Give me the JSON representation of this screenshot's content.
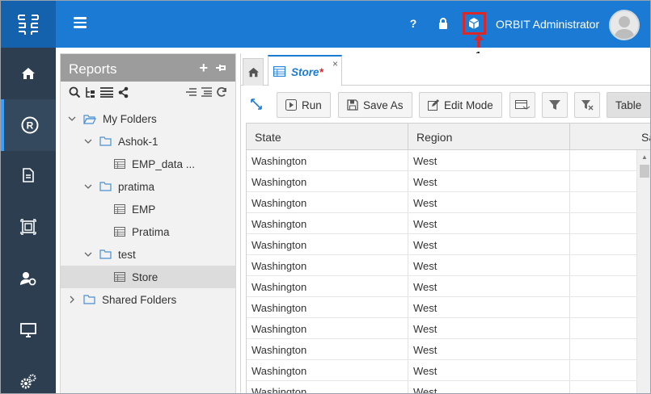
{
  "header": {
    "admin_name": "ORBIT Administrator",
    "callout_number": "1",
    "icons": [
      "menu-icon",
      "help-icon",
      "lock-icon",
      "cube-icon",
      "user-avatar"
    ]
  },
  "leftnav": {
    "items": [
      "home-icon",
      "registered-icon",
      "document-icon",
      "dashboard-icon",
      "user-gear-icon",
      "monitor-icon",
      "settings-icon"
    ]
  },
  "reports": {
    "title": "Reports",
    "tree": [
      {
        "label": "My Folders",
        "type": "folder-open",
        "level": 0,
        "expanded": true
      },
      {
        "label": "Ashok-1",
        "type": "folder",
        "level": 1,
        "expanded": true
      },
      {
        "label": "EMP_data ...",
        "type": "report",
        "level": 2
      },
      {
        "label": "pratima",
        "type": "folder",
        "level": 1,
        "expanded": true
      },
      {
        "label": "EMP",
        "type": "report",
        "level": 2
      },
      {
        "label": "Pratima",
        "type": "report",
        "level": 2
      },
      {
        "label": "test",
        "type": "folder",
        "level": 1,
        "expanded": true
      },
      {
        "label": "Store",
        "type": "report",
        "level": 2,
        "selected": true
      },
      {
        "label": "Shared Folders",
        "type": "folder",
        "level": 0,
        "expanded": false
      }
    ]
  },
  "tabs": {
    "store_label": "Store",
    "modified_marker": "*",
    "close_symbol": "×"
  },
  "toolbar": {
    "run_label": "Run",
    "save_as_label": "Save As",
    "edit_mode_label": "Edit Mode",
    "table_label": "Table"
  },
  "grid": {
    "columns": [
      "State",
      "Region",
      "Sa"
    ],
    "rows": [
      [
        "Washington",
        "West",
        ""
      ],
      [
        "Washington",
        "West",
        ""
      ],
      [
        "Washington",
        "West",
        ""
      ],
      [
        "Washington",
        "West",
        ""
      ],
      [
        "Washington",
        "West",
        ""
      ],
      [
        "Washington",
        "West",
        ""
      ],
      [
        "Washington",
        "West",
        ""
      ],
      [
        "Washington",
        "West",
        ""
      ],
      [
        "Washington",
        "West",
        ""
      ],
      [
        "Washington",
        "West",
        ""
      ],
      [
        "Washington",
        "West",
        ""
      ],
      [
        "Washington",
        "West",
        ""
      ]
    ]
  },
  "colors": {
    "topbar": "#1a7ad4",
    "nav": "#2c3e50",
    "accent": "#1a7ad4",
    "highlight": "#d8282b"
  }
}
